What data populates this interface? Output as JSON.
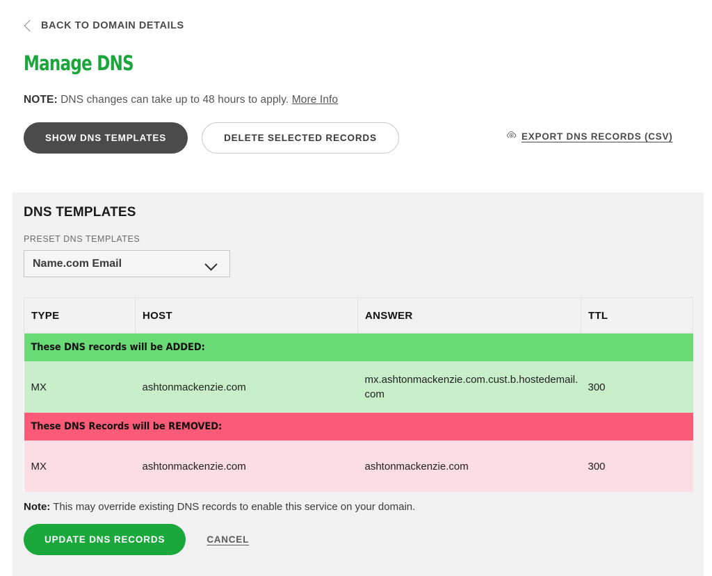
{
  "breadcrumb": {
    "back_label": "BACK TO DOMAIN DETAILS",
    "icon": "chevron-left-icon"
  },
  "header": {
    "title": "Manage DNS",
    "title_color": "#1ba53c",
    "note_prefix": "NOTE:",
    "note_text": " DNS changes can take up to 48 hours to apply. ",
    "note_link": "More Info"
  },
  "toolbar": {
    "show_templates_label": "SHOW DNS TEMPLATES",
    "delete_selected_label": "DELETE SELECTED RECORDS",
    "export_label": "EXPORT DNS RECORDS (CSV)",
    "export_icon": "cloud-download-icon"
  },
  "templates_panel": {
    "title": "DNS TEMPLATES",
    "preset_field_label": "PRESET DNS TEMPLATES",
    "preset_selected": "Name.com Email",
    "preset_icon": "chevron-down-icon",
    "table": {
      "columns": [
        "TYPE",
        "HOST",
        "ANSWER",
        "TTL"
      ],
      "added_band_label": "These DNS records will be ADDED:",
      "added_band_color": "#6ada77",
      "added_row_color": "#c7edc9",
      "removed_band_label": "These DNS Records will be REMOVED:",
      "removed_band_color": "#fb5b76",
      "removed_row_color": "#fcdde4",
      "added_rows": [
        {
          "type": "MX",
          "host": "ashtonmackenzie.com",
          "answer": "mx.ashtonmackenzie.com.cust.b.hostedemail.com",
          "ttl": "300"
        }
      ],
      "removed_rows": [
        {
          "type": "MX",
          "host": "ashtonmackenzie.com",
          "answer": "ashtonmackenzie.com",
          "ttl": "300"
        }
      ]
    },
    "footer": {
      "note_prefix": "Note:",
      "note_text": " This may override existing DNS records to enable this service on your domain.",
      "update_label": "UPDATE DNS RECORDS",
      "cancel_label": "CANCEL",
      "update_color": "#1aa83c"
    }
  }
}
